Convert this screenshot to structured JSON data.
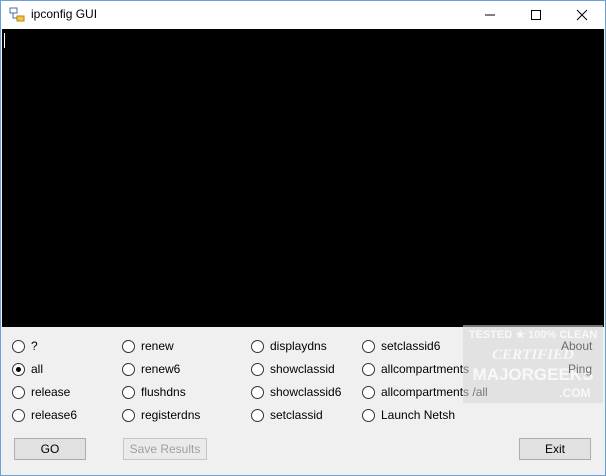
{
  "window": {
    "title": "ipconfig GUI"
  },
  "options": {
    "col1": [
      {
        "label": "?",
        "checked": false
      },
      {
        "label": "all",
        "checked": true
      },
      {
        "label": "release",
        "checked": false
      },
      {
        "label": "release6",
        "checked": false
      }
    ],
    "col2": [
      {
        "label": "renew",
        "checked": false
      },
      {
        "label": "renew6",
        "checked": false
      },
      {
        "label": "flushdns",
        "checked": false
      },
      {
        "label": "registerdns",
        "checked": false
      }
    ],
    "col3": [
      {
        "label": "displaydns",
        "checked": false
      },
      {
        "label": "showclassid",
        "checked": false
      },
      {
        "label": "showclassid6",
        "checked": false
      },
      {
        "label": "setclassid",
        "checked": false
      }
    ],
    "col4": [
      {
        "label": "setclassid6",
        "checked": false
      },
      {
        "label": "allcompartments",
        "checked": false
      },
      {
        "label": "allcompartments /all",
        "checked": false
      },
      {
        "label": "Launch Netsh",
        "checked": false
      }
    ]
  },
  "links": {
    "about": "About",
    "ping": "Ping"
  },
  "buttons": {
    "go": "GO",
    "save": "Save Results",
    "exit": "Exit"
  },
  "watermark": {
    "line1": "TESTED ★ 100% CLEAN",
    "line2": "CERTIFIED",
    "line3": "MAJORGEEKS",
    "line4": ".COM"
  }
}
